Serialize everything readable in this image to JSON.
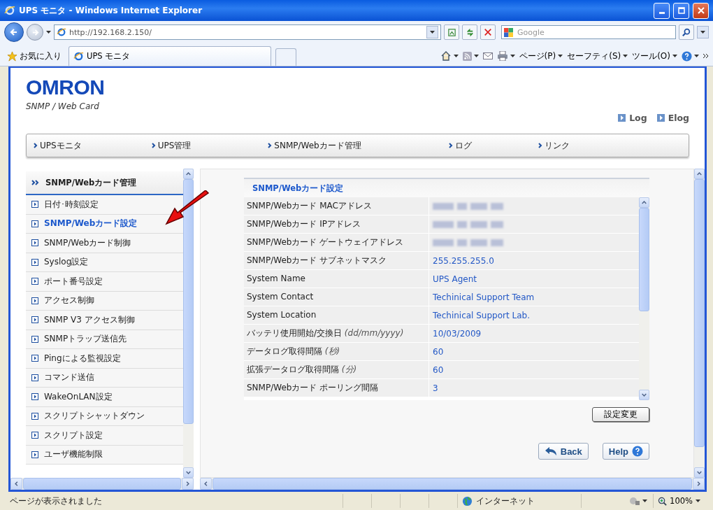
{
  "window": {
    "title": "UPS モニタ - Windows Internet Explorer"
  },
  "address_bar": {
    "url": "http://192.168.2.150/",
    "search_placeholder": "Google"
  },
  "favorites": {
    "label": "お気に入り"
  },
  "tabs": [
    {
      "label": "UPS モニタ",
      "selected": true
    }
  ],
  "command_bar": [
    "ページ(P)",
    "セーフティ(S)",
    "ツール(O)"
  ],
  "header": {
    "logo": "OMRON",
    "subtitle": "SNMP / Web Card",
    "links": [
      "Log",
      "Elog"
    ]
  },
  "nav": [
    "UPSモニタ",
    "UPS管理",
    "SNMP/Webカード管理",
    "ログ",
    "リンク"
  ],
  "sidebar": {
    "title": "SNMP/Webカード管理",
    "items": [
      {
        "label": "日付･時刻設定",
        "selected": false
      },
      {
        "label": "SNMP/Webカード設定",
        "selected": true
      },
      {
        "label": "SNMP/Webカード制御",
        "selected": false
      },
      {
        "label": "Syslog設定",
        "selected": false
      },
      {
        "label": "ポート番号設定",
        "selected": false
      },
      {
        "label": "アクセス制御",
        "selected": false
      },
      {
        "label": "SNMP V3 アクセス制御",
        "selected": false
      },
      {
        "label": "SNMPトラップ送信先",
        "selected": false
      },
      {
        "label": "Pingによる監視設定",
        "selected": false
      },
      {
        "label": "コマンド送信",
        "selected": false
      },
      {
        "label": "WakeOnLAN設定",
        "selected": false
      },
      {
        "label": "スクリプトシャットダウン",
        "selected": false
      },
      {
        "label": "スクリプト設定",
        "selected": false
      },
      {
        "label": "ユーザ機能制限",
        "selected": false
      }
    ]
  },
  "panel": {
    "title": "SNMP/Webカード設定",
    "rows": [
      {
        "label": "SNMP/Webカード MACアドレス",
        "kind": "redacted"
      },
      {
        "label": "SNMP/Webカード IPアドレス",
        "kind": "redacted"
      },
      {
        "label": "SNMP/Webカード ゲートウェイアドレス",
        "kind": "redacted"
      },
      {
        "label": "SNMP/Webカード サブネットマスク",
        "kind": "text",
        "value": "255.255.255.0"
      },
      {
        "label": "System Name",
        "kind": "text",
        "value": "UPS Agent"
      },
      {
        "label": "System Contact",
        "kind": "text",
        "value": "Techinical Support Team"
      },
      {
        "label": "System Location",
        "kind": "text",
        "value": "Techinical Support Lab."
      },
      {
        "label": "バッテリ使用開始/交換日 *(dd/mm/yyyy)*",
        "kind": "text",
        "value": "10/03/2009"
      },
      {
        "label": "データログ取得間隔 *(秒)*",
        "kind": "text",
        "value": "60"
      },
      {
        "label": "拡張データログ取得間隔 *(分)*",
        "kind": "text",
        "value": "60"
      },
      {
        "label": "SNMP/Webカード ポーリング間隔",
        "kind": "text",
        "value": "3"
      }
    ],
    "apply_button": "設定変更",
    "back_button": "Back",
    "help_button": "Help"
  },
  "status_bar": {
    "text": "ページが表示されました",
    "zone": "インターネット",
    "zoom": "100%"
  }
}
